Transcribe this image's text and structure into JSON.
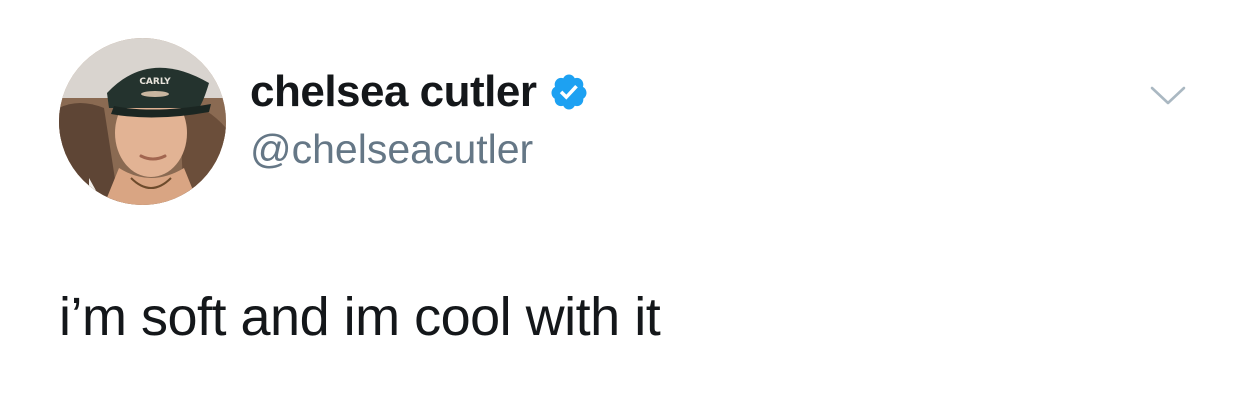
{
  "author": {
    "display_name": "chelsea cutler",
    "handle": "@chelseacutler",
    "verified": true,
    "avatar_cap_text": "CARLY"
  },
  "tweet": {
    "text": "i’m soft and im cool with it"
  },
  "icons": {
    "verified_badge": "verified-badge-icon",
    "menu": "chevron-down-icon"
  },
  "colors": {
    "name": "#14171a",
    "handle": "#657786",
    "verified": "#1da1f2",
    "caret": "#aab8c2",
    "text": "#14171a"
  }
}
